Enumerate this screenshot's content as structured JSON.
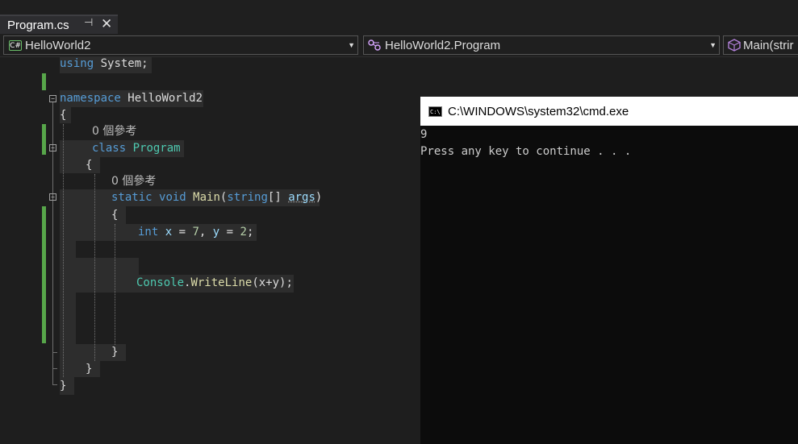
{
  "tab": {
    "title": "Program.cs",
    "pin_glyph": "⊣",
    "close_glyph": "✕"
  },
  "navbar": {
    "project": "HelloWorld2",
    "class": "HelloWorld2.Program",
    "member": "Main(strir",
    "project_icon": "csharp-project-icon",
    "class_icon": "class-icon",
    "member_icon": "method-cube-icon"
  },
  "code": {
    "using_kw": "using",
    "using_ns": "System;",
    "namespace_kw": "namespace",
    "namespace_name": "HelloWorld2",
    "open_brace": "{",
    "close_brace": "}",
    "refs_class": "0 個參考",
    "class_kw": "class",
    "class_name": "Program",
    "refs_main": "0 個參考",
    "static_kw": "static",
    "void_kw": "void",
    "main_name": "Main",
    "string_kw": "string",
    "brackets": "[]",
    "args_name": "args",
    "int_kw": "int",
    "decl_x": "x",
    "eq": "=",
    "seven": "7",
    "comma": ",",
    "decl_y": "y",
    "two": "2",
    "semi": ";",
    "console_cls": "Console",
    "writeline": "WriteLine",
    "call_args": "(x+y);",
    "collapse_glyph": "−"
  },
  "console": {
    "title": "C:\\WINDOWS\\system32\\cmd.exe",
    "icon_text": "C:\\",
    "output": [
      "9",
      "Press any key to continue . . ."
    ]
  },
  "colors": {
    "keyword": "#569cd6",
    "type": "#4ec9b0",
    "method": "#dcdcaa",
    "number": "#b5cea8",
    "change_bar": "#57a64a",
    "editor_bg": "#1e1e1e",
    "console_bg": "#0c0c0c"
  }
}
